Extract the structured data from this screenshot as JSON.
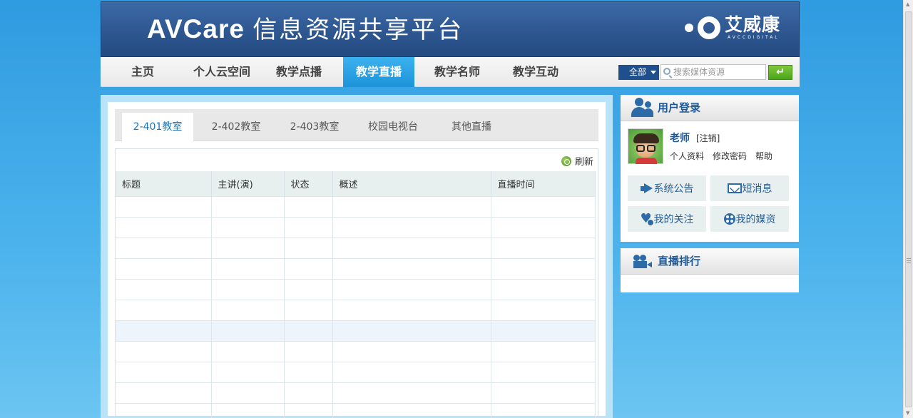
{
  "header": {
    "title_en": "AVCare",
    "title_cn": "信息资源共享平台",
    "brand_name": "艾威康",
    "brand_sub": "AVCCDIGITAL"
  },
  "nav": {
    "items": [
      {
        "label": "主页"
      },
      {
        "label": "个人云空间"
      },
      {
        "label": "教学点播"
      },
      {
        "label": "教学直播",
        "active": true
      },
      {
        "label": "教学名师"
      },
      {
        "label": "教学互动"
      }
    ],
    "scope_value": "全部",
    "search_placeholder": "搜索媒体资源",
    "go_label": "↵"
  },
  "main": {
    "tabs": [
      {
        "label": "2-401教室",
        "active": true
      },
      {
        "label": "2-402教室"
      },
      {
        "label": "2-403教室"
      },
      {
        "label": "校园电视台"
      },
      {
        "label": "其他直播"
      }
    ],
    "refresh_label": "刷新",
    "columns": [
      "标题",
      "主讲(演)",
      "状态",
      "概述",
      "直播时间"
    ]
  },
  "login": {
    "title": "用户登录",
    "username": "老师",
    "logout": "[注销]",
    "links": [
      "个人资料",
      "修改密码",
      "帮助"
    ],
    "buttons": [
      {
        "label": "系统公告",
        "icon": "megaphone-icon"
      },
      {
        "label": "短消息",
        "icon": "mail-icon"
      },
      {
        "label": "我的关注",
        "icon": "heart-icon"
      },
      {
        "label": "我的媒资",
        "icon": "film-reel-icon"
      }
    ]
  },
  "ranking": {
    "title": "直播排行"
  },
  "colors": {
    "accent": "#1c93d9",
    "header": "#2e5791",
    "link": "#1f5a96",
    "go_button": "#4ca51a"
  }
}
